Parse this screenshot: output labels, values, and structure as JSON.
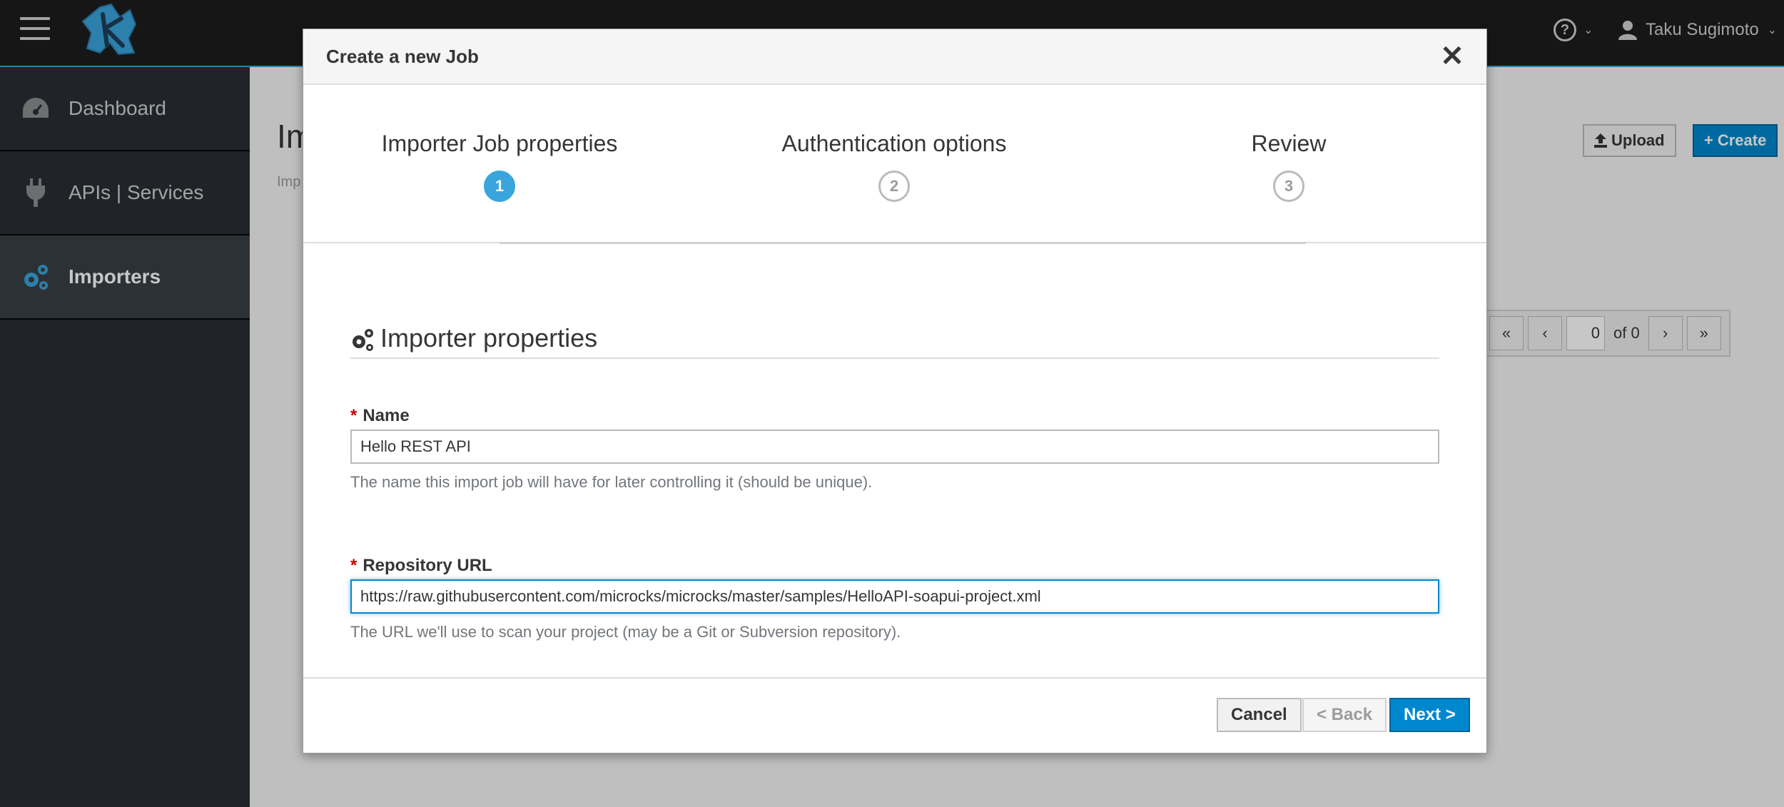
{
  "topbar": {
    "user_name": "Taku Sugimoto",
    "help_caret": "⌄",
    "user_caret": "⌄"
  },
  "sidebar": {
    "items": [
      {
        "label": "Dashboard",
        "icon": "dashboard-icon",
        "active": false
      },
      {
        "label": "APIs | Services",
        "icon": "plug-icon",
        "active": false
      },
      {
        "label": "Importers",
        "icon": "cogs-icon",
        "active": true
      }
    ]
  },
  "content": {
    "page_title_partial": "Im",
    "breadcrumb_partial": "Imp",
    "upload_label": "Upload",
    "create_label": "Create",
    "pager": {
      "first": "«",
      "prev": "‹",
      "current_page": "0",
      "of_text": "of 0",
      "next": "›",
      "last": "»"
    }
  },
  "modal": {
    "title": "Create a new Job",
    "close_glyph": "✕",
    "steps": [
      {
        "label": "Importer Job properties",
        "number": "1",
        "active": true
      },
      {
        "label": "Authentication options",
        "number": "2",
        "active": false
      },
      {
        "label": "Review",
        "number": "3",
        "active": false
      }
    ],
    "section_title": "Importer properties",
    "fields": {
      "name": {
        "label": "Name",
        "required_mark": "*",
        "value": "Hello REST API",
        "help": "The name this import job will have for later controlling it (should be unique)."
      },
      "repository_url": {
        "label": "Repository URL",
        "required_mark": "*",
        "value": "https://raw.githubusercontent.com/microcks/microcks/master/samples/HelloAPI-soapui-project.xml",
        "help": "The URL we'll use to scan your project (may be a Git or Subversion repository)."
      }
    },
    "footer": {
      "cancel_label": "Cancel",
      "back_label": "< Back",
      "next_label": "Next >"
    }
  },
  "colors": {
    "accent": "#0088ce",
    "step_active": "#39a5dc",
    "sidebar_bg": "#292e34",
    "topbar_bg": "#1d1d1d"
  }
}
